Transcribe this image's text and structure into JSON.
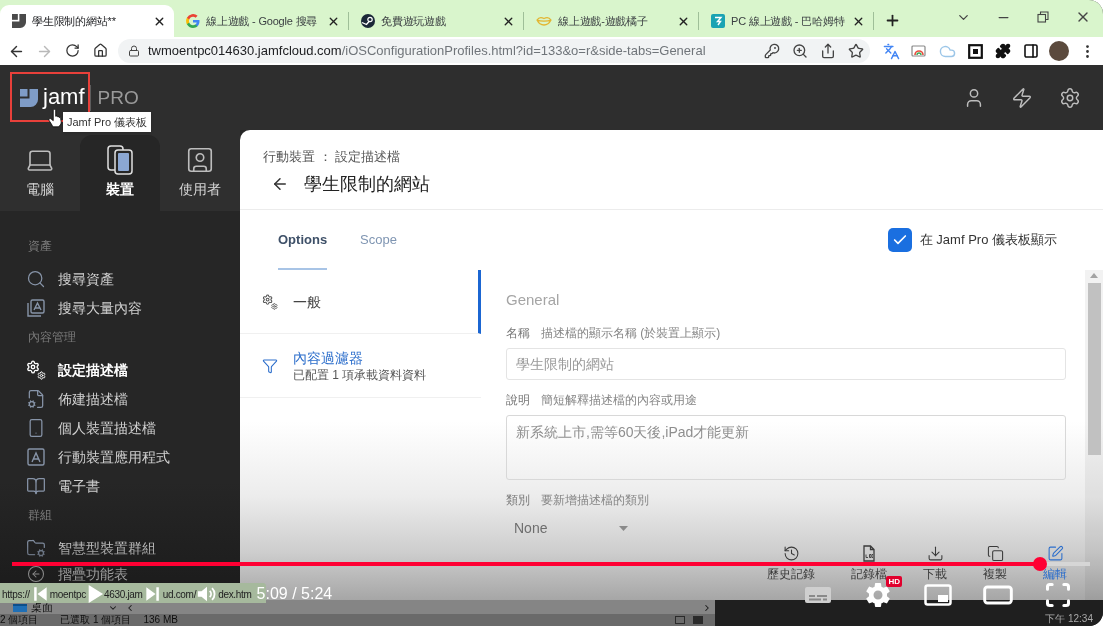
{
  "browser": {
    "tabs": [
      {
        "title": "學生限制的網站**",
        "selected": true
      },
      {
        "title": "線上遊戲 - Google 搜尋",
        "selected": false
      },
      {
        "title": "免費遊玩遊戲",
        "selected": false
      },
      {
        "title": "線上遊戲-遊戲橘子",
        "selected": false
      },
      {
        "title": "PC 線上遊戲 - 巴哈姆特",
        "selected": false
      }
    ],
    "nav": {
      "back_disabled": false,
      "forward_disabled": true
    },
    "address": {
      "host": "twmoentpc014630.jamfcloud.com",
      "path": "/iOSConfigurationProfiles.html?id=133&o=r&side-tabs=General"
    }
  },
  "app": {
    "logo": {
      "wordmark": "jamf",
      "product": "PRO"
    },
    "logo_tooltip": "Jamf Pro 儀表板",
    "nav_tabs": [
      {
        "label": "電腦",
        "selected": false
      },
      {
        "label": "裝置",
        "selected": true
      },
      {
        "label": "使用者",
        "selected": false
      }
    ],
    "sidebar": {
      "sections": [
        {
          "title": "資產",
          "items": [
            {
              "label": "搜尋資產",
              "selected": false
            },
            {
              "label": "搜尋大量內容",
              "selected": false
            }
          ]
        },
        {
          "title": "內容管理",
          "items": [
            {
              "label": "設定描述檔",
              "selected": true
            },
            {
              "label": "佈建描述檔",
              "selected": false
            },
            {
              "label": "個人裝置描述檔",
              "selected": false
            },
            {
              "label": "行動裝置應用程式",
              "selected": false
            },
            {
              "label": "電子書",
              "selected": false
            }
          ]
        },
        {
          "title": "群組",
          "items": [
            {
              "label": "智慧型裝置群組",
              "selected": false
            }
          ]
        }
      ],
      "collapse_label": "摺疊功能表"
    },
    "page": {
      "breadcrumb": "行動裝置 ： 設定描述檔",
      "title": "學生限制的網站",
      "tabs": [
        {
          "label": "Options",
          "selected": true
        },
        {
          "label": "Scope",
          "selected": false
        }
      ],
      "dashboard_checkbox": {
        "label": "在 Jamf Pro 儀表板顯示",
        "checked": true
      },
      "payloads": [
        {
          "label": "一般",
          "selected": true,
          "configured": false
        },
        {
          "label": "內容過濾器",
          "detail": "已配置 1 項承載資料資料",
          "selected": false,
          "configured": true
        }
      ],
      "form": {
        "heading": "General",
        "fields": [
          {
            "kind": "text",
            "label": "名稱",
            "hint": "描述檔的顯示名稱 (於裝置上顯示)",
            "value": "學生限制的網站"
          },
          {
            "kind": "textarea",
            "label": "說明",
            "hint": "簡短解釋描述檔的內容或用途",
            "value": "新系統上市,需等60天後,iPad才能更新"
          },
          {
            "kind": "select",
            "label": "類別",
            "hint": "要新增描述檔的類別",
            "value": "None"
          }
        ]
      },
      "actions": [
        {
          "label": "歷史記錄",
          "primary": false
        },
        {
          "label": "記錄檔",
          "primary": false
        },
        {
          "label": "下載",
          "primary": false
        },
        {
          "label": "複製",
          "primary": false
        },
        {
          "label": "編輯",
          "primary": true
        }
      ]
    }
  },
  "link_status": {
    "fragments": [
      "https://",
      "moentpc",
      "4630.jam",
      "ud.com/",
      "dex.htm"
    ]
  },
  "player": {
    "progress": {
      "level": 0.954
    },
    "time": "5:09 / 5:24",
    "quality_badge": "HD"
  },
  "taskbar": {
    "location": "桌面",
    "item_count": "2 個項目",
    "selection": "已選取 1 個項目",
    "size": "136 MB",
    "clock": "下午 12:34"
  }
}
